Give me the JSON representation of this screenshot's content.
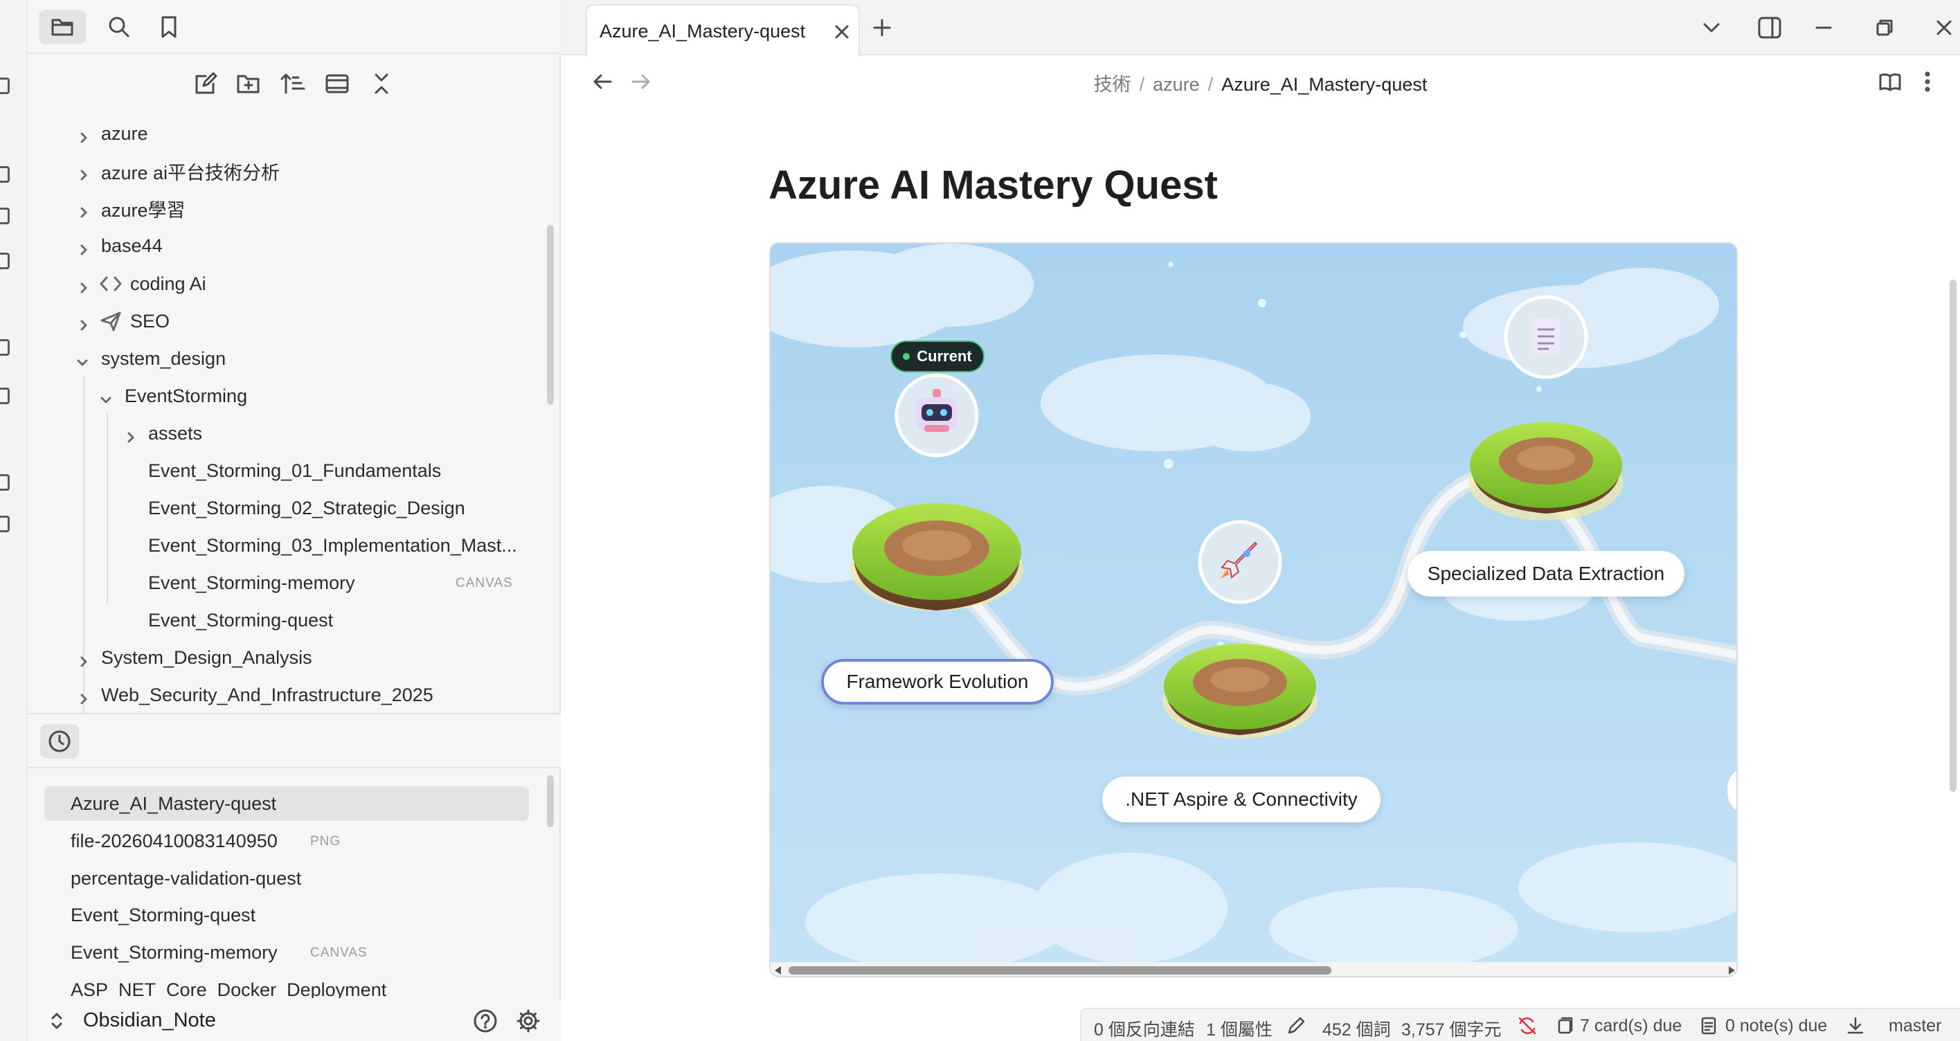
{
  "sidebar": {
    "tree": [
      {
        "label": "azure",
        "expanded": false
      },
      {
        "label": "azure ai平台技術分析",
        "expanded": false
      },
      {
        "label": "azure學習",
        "expanded": false
      },
      {
        "label": "base44",
        "expanded": false
      },
      {
        "label": "coding Ai",
        "expanded": false,
        "icon": "code-icon"
      },
      {
        "label": "SEO",
        "expanded": false,
        "icon": "send-icon"
      },
      {
        "label": "system_design",
        "expanded": true
      },
      {
        "label": "EventStorming",
        "expanded": true
      },
      {
        "label": "assets",
        "expanded": false
      },
      {
        "label": "Event_Storming_01_Fundamentals"
      },
      {
        "label": "Event_Storming_02_Strategic_Design"
      },
      {
        "label": "Event_Storming_03_Implementation_Mast..."
      },
      {
        "label": "Event_Storming-memory",
        "badge": "CANVAS"
      },
      {
        "label": "Event_Storming-quest"
      },
      {
        "label": "System_Design_Analysis",
        "expanded": false
      },
      {
        "label": "Web_Security_And_Infrastructure_2025",
        "expanded": false
      }
    ],
    "recent": [
      {
        "label": "Azure_AI_Mastery-quest",
        "active": true
      },
      {
        "label": "file-20260410083140950",
        "badge": "PNG"
      },
      {
        "label": "percentage-validation-quest"
      },
      {
        "label": "Event_Storming-quest"
      },
      {
        "label": "Event_Storming-memory",
        "badge": "CANVAS"
      },
      {
        "label": "ASP_NET_Core_Docker_Deployment"
      }
    ],
    "vault_name": "Obsidian_Note"
  },
  "tab": {
    "title": "Azure_AI_Mastery-quest"
  },
  "breadcrumb": {
    "parts": [
      "技術",
      "azure"
    ],
    "current": "Azure_AI_Mastery-quest"
  },
  "note": {
    "title": "Azure AI Mastery Quest"
  },
  "quest_map": {
    "current_badge": "Current",
    "stages": [
      {
        "label": "Framework Evolution",
        "current": true
      },
      {
        "label": ".NET Aspire & Connectivity"
      },
      {
        "label": "Specialized Data Extraction"
      }
    ],
    "colors": {
      "sky": "#b7d9f1",
      "path": "#e8eef3",
      "grass": "#8fcf3a",
      "soil": "#b07a4e",
      "current_border": "#6f86d6"
    }
  },
  "status": {
    "backlinks": "0 個反向連結",
    "properties": "1 個屬性",
    "words": "452 個詞",
    "chars": "3,757 個字元",
    "cards_due": "7 card(s) due",
    "notes_due": "0 note(s) due",
    "branch": "master"
  }
}
